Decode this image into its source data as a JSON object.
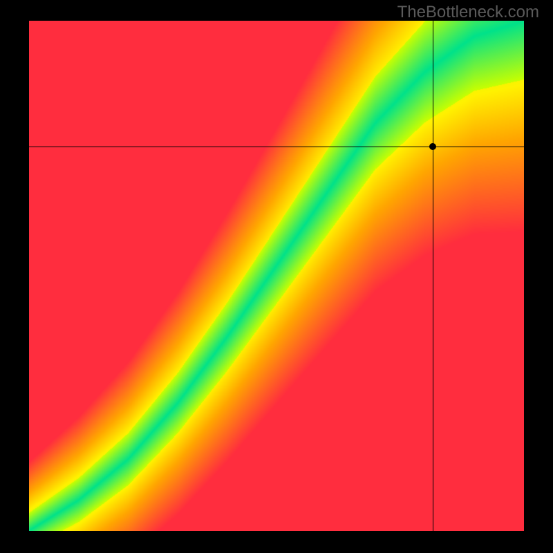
{
  "watermark": "TheBottleneck.com",
  "chart_data": {
    "type": "heatmap",
    "title": "",
    "xlabel": "",
    "ylabel": "",
    "xlim": [
      0,
      1
    ],
    "ylim": [
      0,
      1
    ],
    "marker": {
      "x": 0.815,
      "y": 0.754
    },
    "crosshair": {
      "x": 0.815,
      "y": 0.754
    },
    "optimal_curve": [
      {
        "x": 0.0,
        "y": 0.0
      },
      {
        "x": 0.1,
        "y": 0.06
      },
      {
        "x": 0.2,
        "y": 0.14
      },
      {
        "x": 0.3,
        "y": 0.25
      },
      {
        "x": 0.4,
        "y": 0.38
      },
      {
        "x": 0.5,
        "y": 0.52
      },
      {
        "x": 0.6,
        "y": 0.66
      },
      {
        "x": 0.7,
        "y": 0.8
      },
      {
        "x": 0.8,
        "y": 0.9
      },
      {
        "x": 0.9,
        "y": 0.97
      },
      {
        "x": 1.0,
        "y": 1.0
      }
    ],
    "color_stops": [
      {
        "pos": 0.0,
        "color": "#ff2d3e"
      },
      {
        "pos": 0.45,
        "color": "#ffa600"
      },
      {
        "pos": 0.7,
        "color": "#fff200"
      },
      {
        "pos": 0.9,
        "color": "#c8ff00"
      },
      {
        "pos": 1.0,
        "color": "#00e28a"
      }
    ],
    "description": "2D bottleneck heatmap: green diagonal band = balanced CPU/GPU pairing; red corners = heavy bottleneck. Black crosshair marks a specific hardware pairing."
  }
}
